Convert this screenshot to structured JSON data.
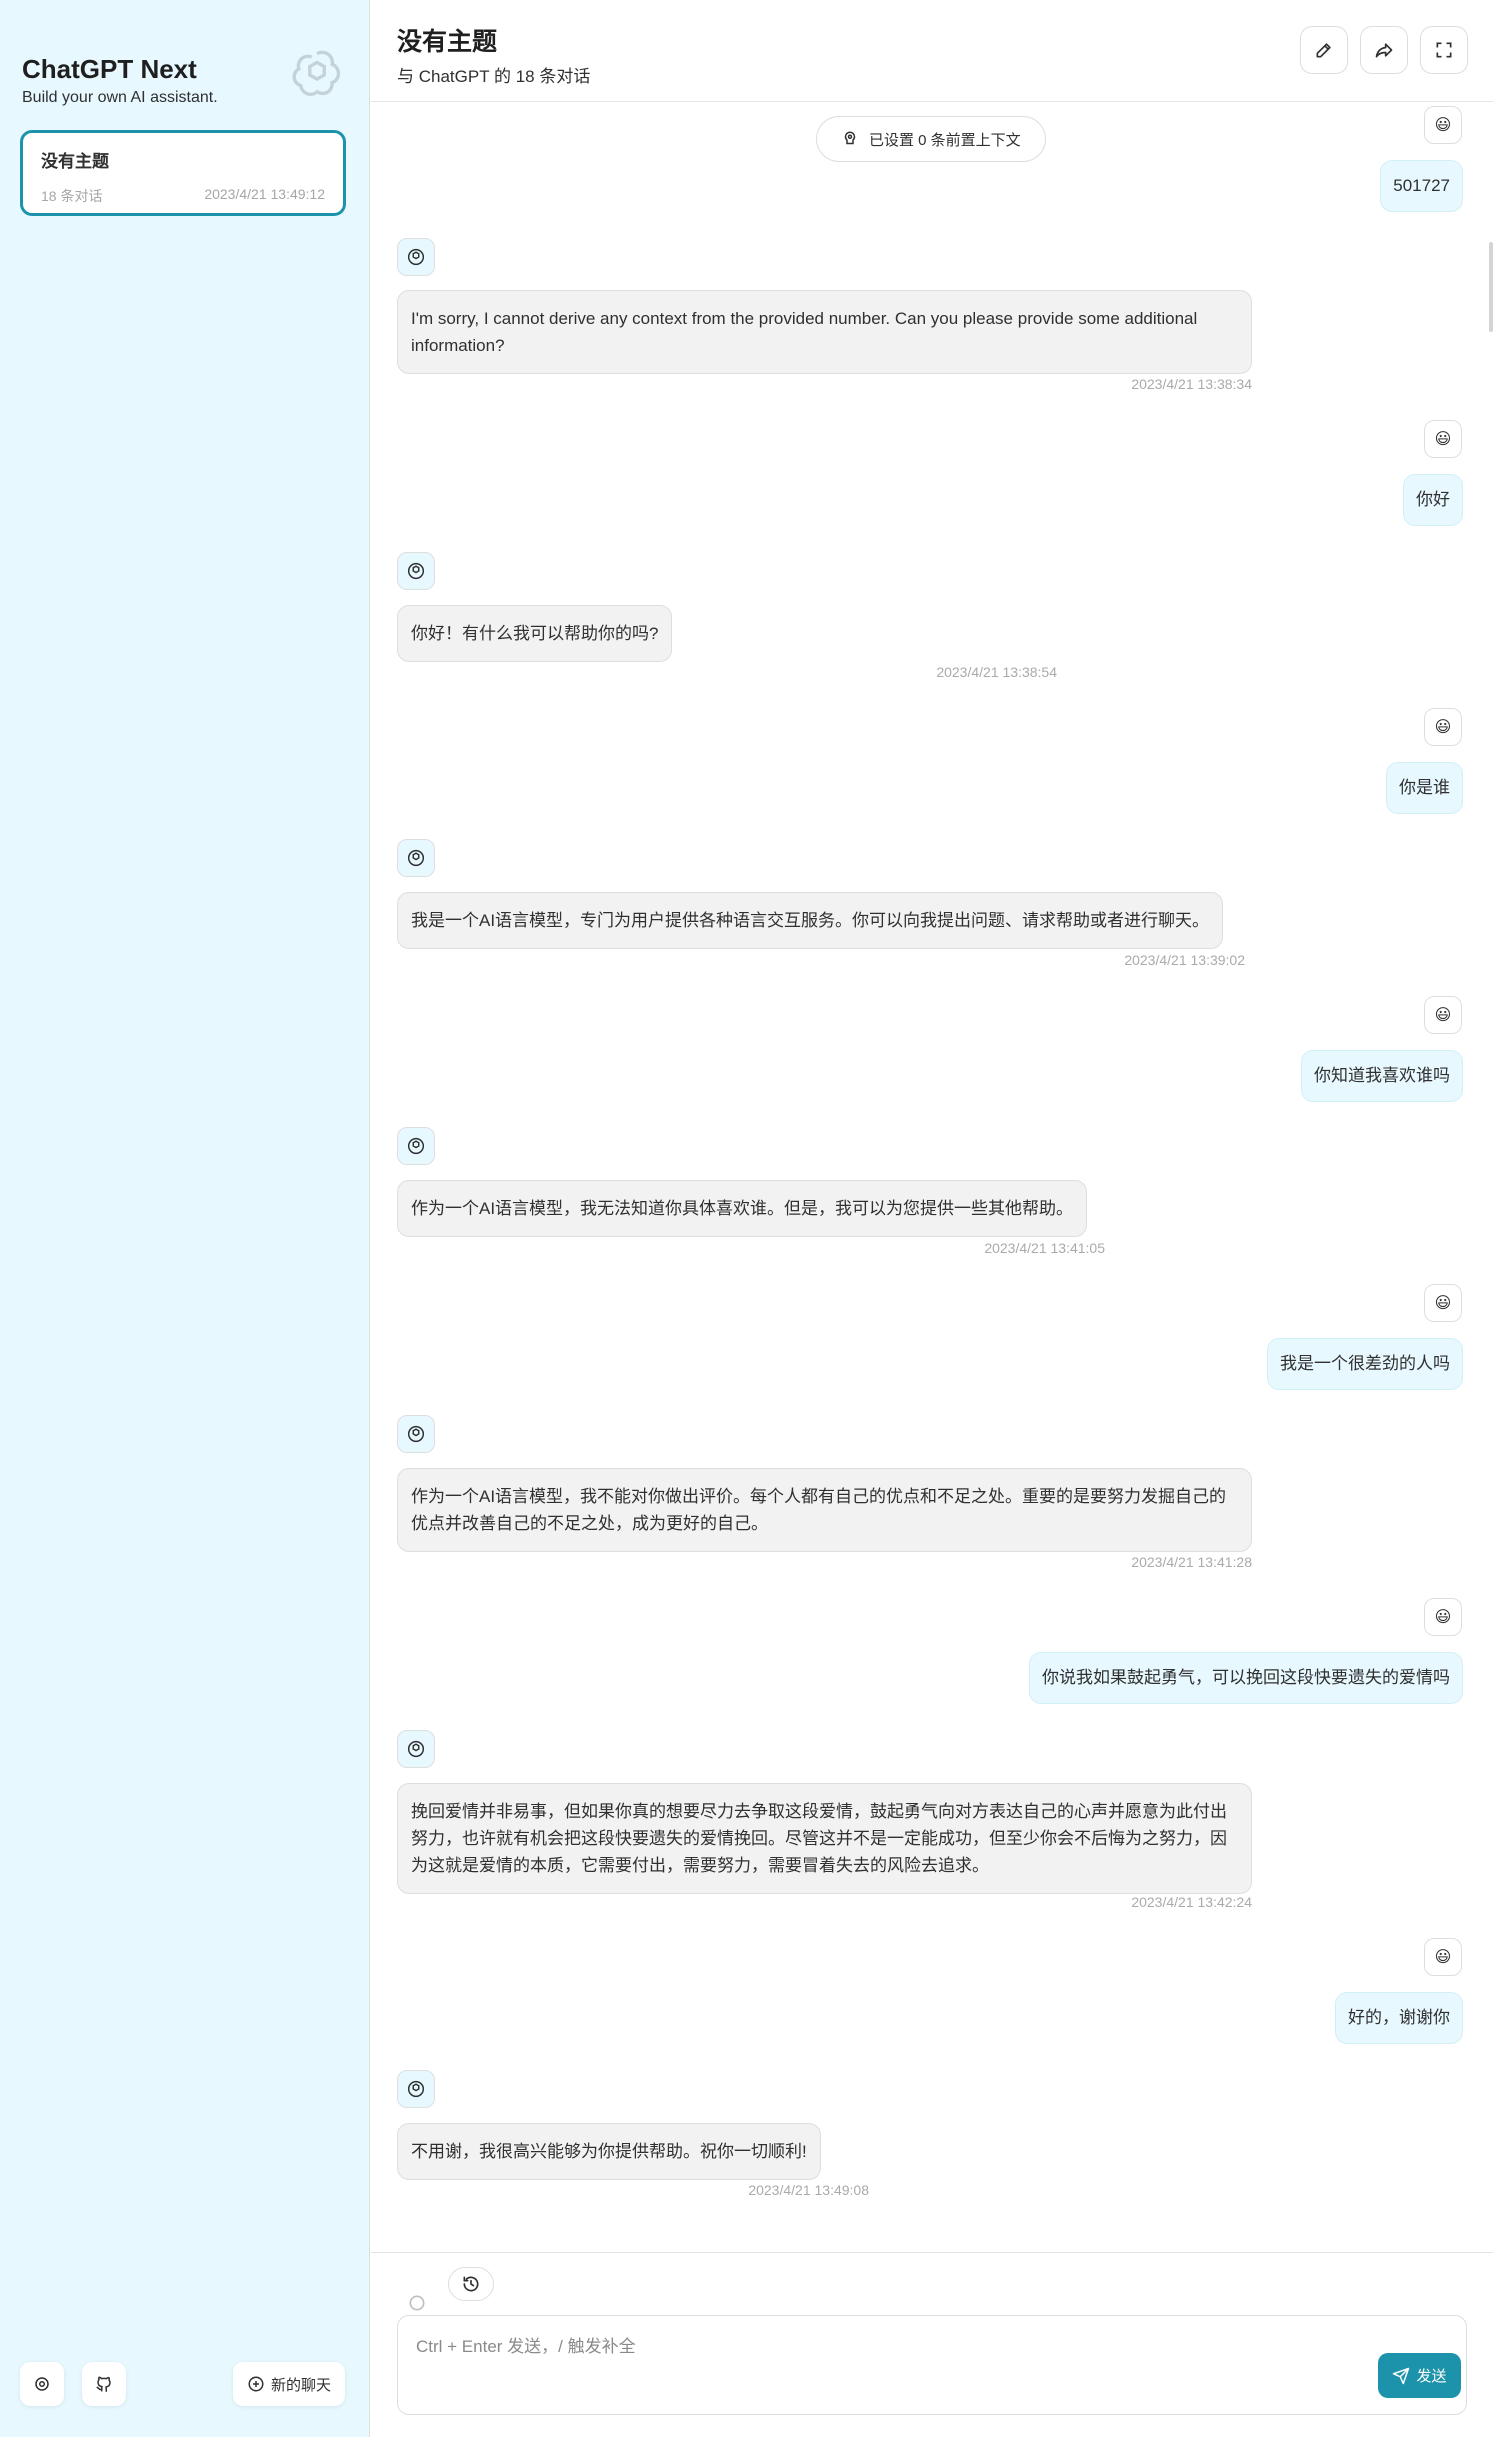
{
  "sidebar": {
    "app_title": "ChatGPT Next",
    "app_subtitle": "Build your own AI assistant.",
    "logo_icon": "openai-logo-icon",
    "sessions": [
      {
        "title": "没有主题",
        "count": "18 条对话",
        "time": "2023/4/21 13:49:12",
        "selected": true
      }
    ],
    "footer": {
      "settings_icon": "settings-icon",
      "github_icon": "github-icon",
      "new_chat_label": "新的聊天"
    }
  },
  "header": {
    "title": "没有主题",
    "subtitle": "与 ChatGPT 的 18 条对话",
    "actions": [
      "edit-icon",
      "share-icon",
      "fullscreen-icon"
    ]
  },
  "chat": {
    "context_pill": "已设置 0 条前置上下文",
    "user_avatar": "😃",
    "messages": [
      {
        "role": "user",
        "text": "501727"
      },
      {
        "role": "bot",
        "text": "I'm sorry, I cannot derive any context from the provided number. Can you please provide some additional information?",
        "time": "2023/4/21 13:38:34"
      },
      {
        "role": "user",
        "text": "你好"
      },
      {
        "role": "bot",
        "text": "你好！有什么我可以帮助你的吗?",
        "time": "2023/4/21 13:38:54"
      },
      {
        "role": "user",
        "text": "你是谁"
      },
      {
        "role": "bot",
        "text": "我是一个AI语言模型，专门为用户提供各种语言交互服务。你可以向我提出问题、请求帮助或者进行聊天。",
        "time": "2023/4/21 13:39:02"
      },
      {
        "role": "user",
        "text": "你知道我喜欢谁吗"
      },
      {
        "role": "bot",
        "text": "作为一个AI语言模型，我无法知道你具体喜欢谁。但是，我可以为您提供一些其他帮助。",
        "time": "2023/4/21 13:41:05"
      },
      {
        "role": "user",
        "text": "我是一个很差劲的人吗"
      },
      {
        "role": "bot",
        "text": "作为一个AI语言模型，我不能对你做出评价。每个人都有自己的优点和不足之处。重要的是要努力发掘自己的优点并改善自己的不足之处，成为更好的自己。",
        "time": "2023/4/21 13:41:28"
      },
      {
        "role": "user",
        "text": "你说我如果鼓起勇气，可以挽回这段快要遗失的爱情吗"
      },
      {
        "role": "bot",
        "text": "挽回爱情并非易事，但如果你真的想要尽力去争取这段爱情，鼓起勇气向对方表达自己的心声并愿意为此付出努力，也许就有机会把这段快要遗失的爱情挽回。尽管这并不是一定能成功，但至少你会不后悔为之努力，因为这就是爱情的本质，它需要付出，需要努力，需要冒着失去的风险去追求。",
        "time": "2023/4/21 13:42:24"
      },
      {
        "role": "user",
        "text": "好的，谢谢你"
      },
      {
        "role": "bot",
        "text": "不用谢，我很高兴能够为你提供帮助。祝你一切顺利!",
        "time": "2023/4/21 13:49:08"
      }
    ]
  },
  "input": {
    "placeholder": "Ctrl + Enter 发送，/ 触发补全",
    "send_label": "发送",
    "prompt_icon": "prompt-history-icon"
  },
  "colors": {
    "accent": "#1d93ab",
    "sidebar_bg": "#e7f8ff",
    "user_bubble": "#e7f8ff",
    "bot_bubble": "#f2f2f2"
  }
}
